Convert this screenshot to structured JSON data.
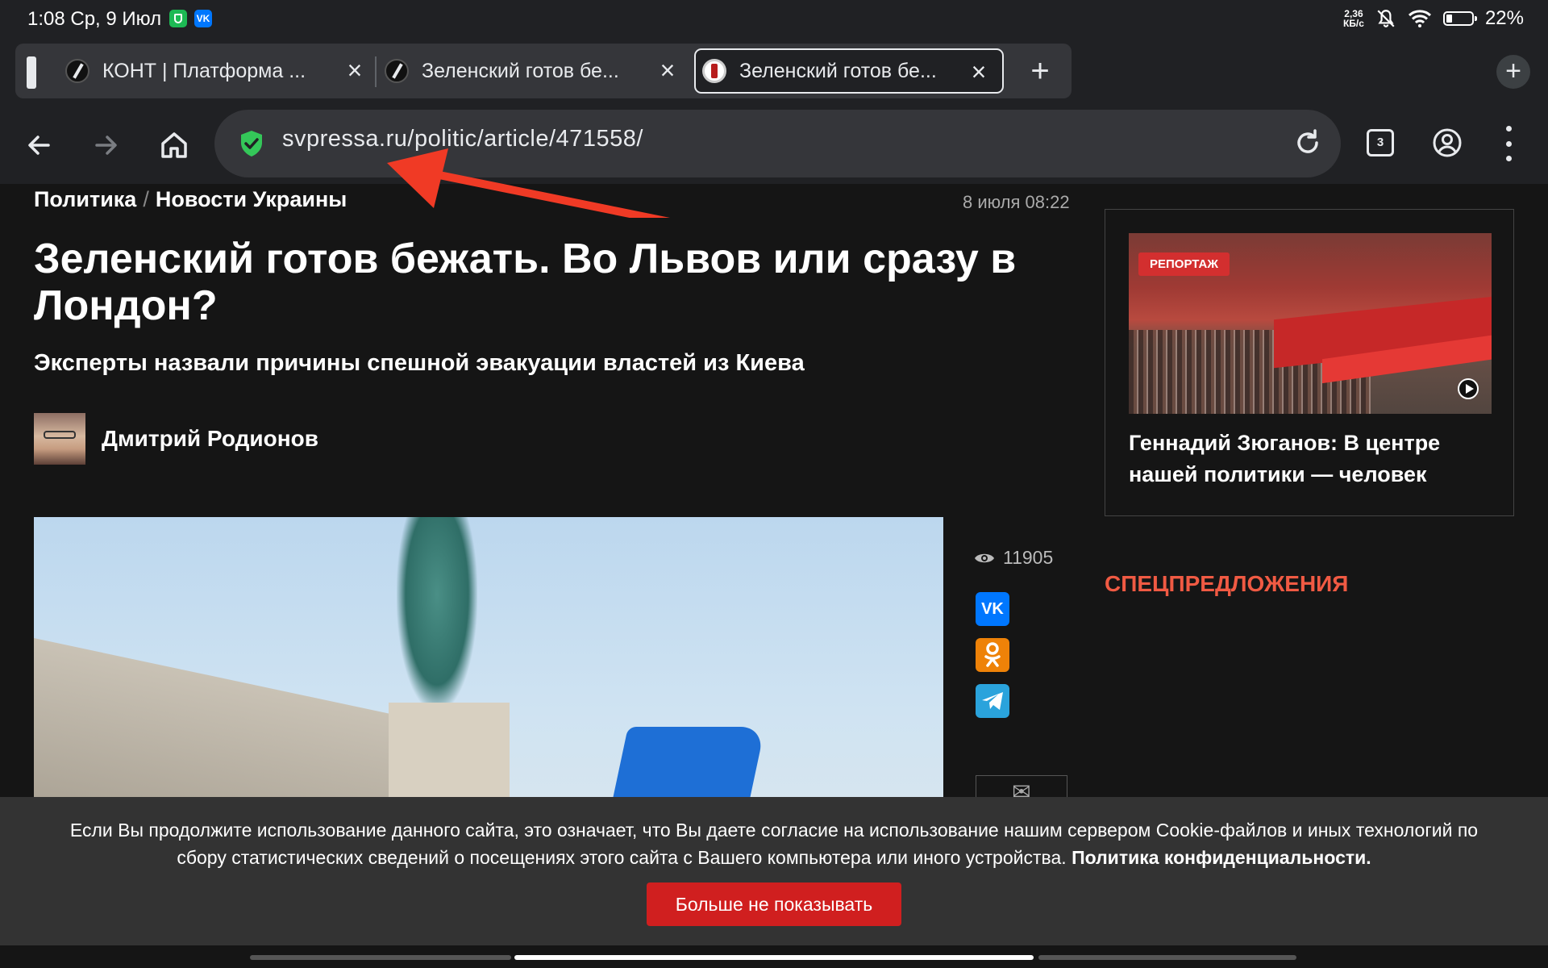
{
  "status_bar": {
    "time": "1:08 Ср, 9 Июл",
    "net_speed_value": "2,36",
    "net_speed_unit": "КБ/с",
    "battery": "22%",
    "notification_icons": [
      "vpn-shield-icon",
      "vk-icon"
    ]
  },
  "tabs": [
    {
      "title": "КОНТ | Платформа ...",
      "active": false
    },
    {
      "title": "Зеленский готов бе...",
      "active": false
    },
    {
      "title": "Зеленский готов бе...",
      "active": true
    }
  ],
  "toolbar": {
    "url": "svpressa.ru/politic/article/471558/",
    "tab_count": "3"
  },
  "article": {
    "breadcrumb_section": "Политика",
    "breadcrumb_separator": "/",
    "breadcrumb_topic": "Новости Украины",
    "date": "8 июля 08:22",
    "title": "Зеленский готов бежать. Во Львов или сразу в Лондон?",
    "subtitle": "Эксперты назвали причины спешной эвакуации властей из Киева",
    "author": "Дмитрий Родионов",
    "views": "11905",
    "share": [
      "vk",
      "ok",
      "telegram"
    ]
  },
  "sidebar": {
    "badge": "РЕПОРТАЖ",
    "caption": "Геннадий Зюганов: В центре нашей политики — человек",
    "special_heading": "СПЕЦПРЕДЛОЖЕНИЯ"
  },
  "cookie": {
    "text": "Если Вы продолжите использование данного сайта, это означает, что Вы даете согласие на использование нашим сервером Cookie-файлов и иных технологий по сбору статистических сведений о посещениях этого сайта с Вашего компьютера или иного устройства.",
    "policy_link": "Политика конфиденциальности.",
    "button": "Больше не показывать"
  },
  "colors": {
    "accent_red": "#d01f1f",
    "special_heading": "#f05a43",
    "shield_green": "#1db954",
    "annotation_arrow": "#f03a25"
  }
}
